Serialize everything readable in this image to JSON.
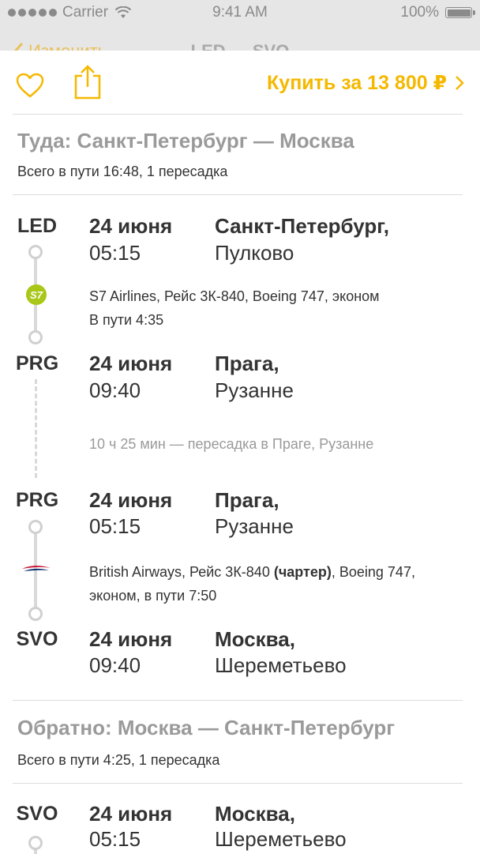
{
  "status_bar": {
    "carrier": "Carrier",
    "time": "9:41 AM",
    "battery": "100%"
  },
  "nav": {
    "back_label": "Изменить",
    "title": "LED — SVO"
  },
  "actions": {
    "buy_label": "Купить за 13 800 ₽"
  },
  "outbound": {
    "title": "Туда: Санкт-Петербург — Москва",
    "summary": "Всего в пути 16:48, 1 пересадка",
    "segments": [
      {
        "dep_iata": "LED",
        "dep_date": "24 июня",
        "dep_time": "05:15",
        "dep_city": "Санкт-Петербург,",
        "dep_airport": "Пулково",
        "airline_logo": "s7-logo",
        "logo_text": "S7",
        "flight_info": "S7 Airlines, Рейс 3К-840, Boeing 747, эконом",
        "duration": "В пути 4:35",
        "arr_iata": "PRG",
        "arr_date": "24 июня",
        "arr_time": "09:40",
        "arr_city": "Прага,",
        "arr_airport": "Рузанне"
      },
      {
        "dep_iata": "PRG",
        "dep_date": "24 июня",
        "dep_time": "05:15",
        "dep_city": "Прага,",
        "dep_airport": "Рузанне",
        "airline_logo": "british-airways-logo",
        "flight_info_prefix": "British Airways, Рейс 3К-840 ",
        "flight_info_bold": "(чартер)",
        "flight_info_suffix": ", Boeing 747,",
        "duration": "эконом, в пути 7:50",
        "arr_iata": "SVO",
        "arr_date": "24 июня",
        "arr_time": "09:40",
        "arr_city": "Москва,",
        "arr_airport": "Шереметьево"
      }
    ],
    "layover": "10 ч 25 мин — пересадка в Праге, Рузанне"
  },
  "return": {
    "title": "Обратно: Москва — Санкт-Петербург",
    "summary": "Всего в пути 4:25, 1 пересадка",
    "first_stop": {
      "iata": "SVO",
      "date": "24 июня",
      "time": "05:15",
      "city": "Москва,",
      "airport": "Шереметьево"
    }
  },
  "colors": {
    "accent": "#f5b800",
    "muted": "#9a9a9a",
    "text": "#333333",
    "line": "#d9d9d9",
    "s7": "#a8c718"
  }
}
